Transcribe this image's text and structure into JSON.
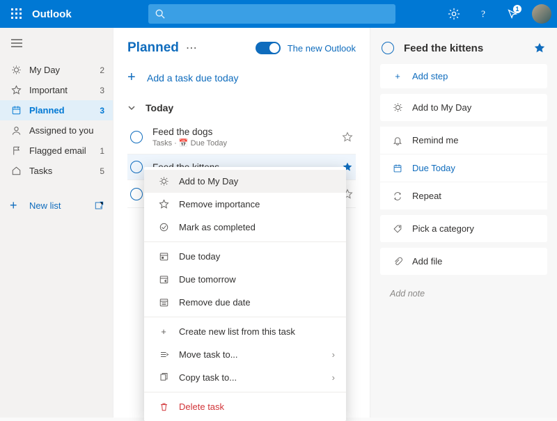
{
  "header": {
    "brand": "Outlook",
    "notif_count": "1"
  },
  "sidebar": {
    "items": [
      {
        "label": "My Day",
        "count": "2"
      },
      {
        "label": "Important",
        "count": "3"
      },
      {
        "label": "Planned",
        "count": "3"
      },
      {
        "label": "Assigned to you",
        "count": ""
      },
      {
        "label": "Flagged email",
        "count": "1"
      },
      {
        "label": "Tasks",
        "count": "5"
      }
    ],
    "newlist": "New list"
  },
  "main": {
    "title": "Planned",
    "toggle_label": "The new Outlook",
    "addtask": "Add a task due today",
    "group_label": "Today",
    "tasks": [
      {
        "title": "Feed the dogs",
        "meta": "Tasks  ·  📅 Due Today",
        "starred": false
      },
      {
        "title": "Feed the kittens",
        "meta": "",
        "starred": true
      }
    ]
  },
  "context": {
    "items": [
      "Add to My Day",
      "Remove importance",
      "Mark as completed",
      "Due today",
      "Due tomorrow",
      "Remove due date",
      "Create new list from this task",
      "Move task to...",
      "Copy task to...",
      "Delete task"
    ]
  },
  "detail": {
    "title": "Feed the kittens",
    "addstep": "Add step",
    "myday": "Add to My Day",
    "remind": "Remind me",
    "due": "Due Today",
    "repeat": "Repeat",
    "category": "Pick a category",
    "addfile": "Add file",
    "note": "Add note"
  }
}
